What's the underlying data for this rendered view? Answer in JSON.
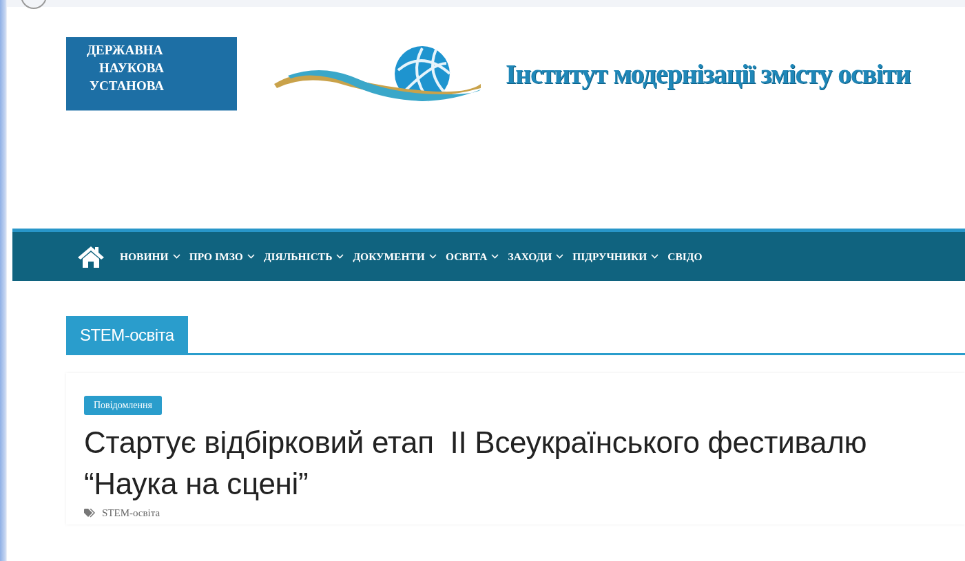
{
  "header": {
    "badge_lines": [
      "ДЕРЖАВНА",
      "НАУКОВА",
      "УСТАНОВА"
    ],
    "title": "Інститут модернізації змісту освіти"
  },
  "nav": {
    "items": [
      {
        "label": "НОВИНИ",
        "dropdown": true
      },
      {
        "label": "ПРО ІМЗО",
        "dropdown": true
      },
      {
        "label": "ДІЯЛЬНІСТЬ",
        "dropdown": true
      },
      {
        "label": "ДОКУМЕНТИ",
        "dropdown": true
      },
      {
        "label": "ОСВІТА",
        "dropdown": true
      },
      {
        "label": "ЗАХОДИ",
        "dropdown": true
      },
      {
        "label": "ПІДРУЧНИКИ",
        "dropdown": true
      },
      {
        "label": "СВІДО",
        "dropdown": false
      }
    ]
  },
  "section": {
    "title": "STEM-освіта"
  },
  "post": {
    "category": "Повідомлення",
    "title": "Стартує відбірковий етап  II Всеукраїнського фестивалю “Наука на сцені”",
    "tags": [
      "STEM-освіта"
    ]
  }
}
